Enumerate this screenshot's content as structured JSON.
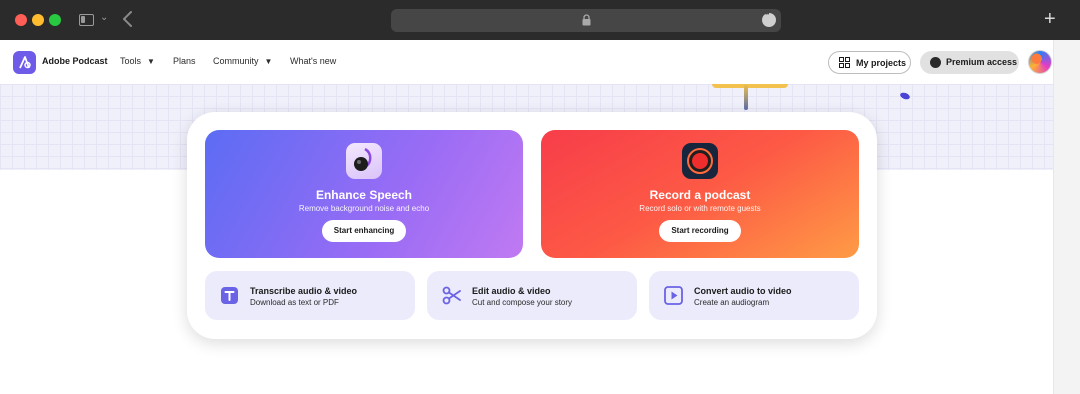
{
  "colors": {
    "brand": "#6e5be8",
    "enhance_gradient": [
      "#5c6cf4",
      "#c07af2"
    ],
    "record_gradient": [
      "#f73d4a",
      "#fe9b45"
    ],
    "small_card_bg": "#ebebfb"
  },
  "header": {
    "brand": "Adobe Podcast",
    "nav": {
      "tools": "Tools",
      "plans": "Plans",
      "community": "Community",
      "whats_new": "What's new"
    },
    "my_projects": "My projects",
    "premium": "Premium access"
  },
  "cards": {
    "enhance": {
      "title": "Enhance Speech",
      "subtitle": "Remove background noise and echo",
      "button": "Start enhancing",
      "icon": "enhance-speech-icon"
    },
    "record": {
      "title": "Record a podcast",
      "subtitle": "Record solo or with remote guests",
      "button": "Start recording",
      "icon": "record-icon"
    }
  },
  "tools": [
    {
      "title": "Transcribe audio & video",
      "subtitle": "Download as text or PDF",
      "icon": "transcribe-icon"
    },
    {
      "title": "Edit audio & video",
      "subtitle": "Cut and compose your story",
      "icon": "scissors-icon"
    },
    {
      "title": "Convert audio to video",
      "subtitle": "Create an audiogram",
      "icon": "play-icon"
    }
  ]
}
